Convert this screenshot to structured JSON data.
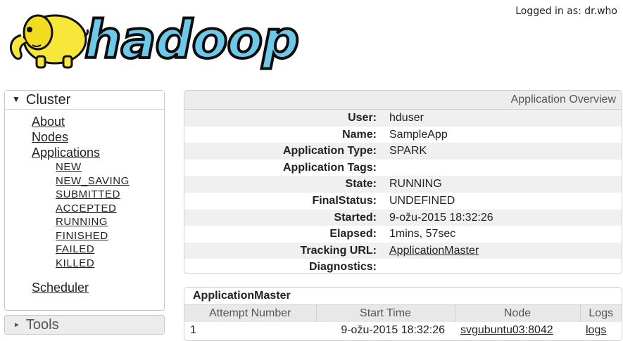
{
  "header": {
    "logo_text": "hadoop",
    "logged_in": "Logged in as: dr.who"
  },
  "sidebar": {
    "cluster": {
      "title": "Cluster",
      "links": [
        "About",
        "Nodes",
        "Applications"
      ],
      "app_states": [
        "NEW",
        "NEW_SAVING",
        "SUBMITTED",
        "ACCEPTED",
        "RUNNING",
        "FINISHED",
        "FAILED",
        "KILLED"
      ],
      "scheduler": "Scheduler"
    },
    "tools": {
      "title": "Tools"
    }
  },
  "overview": {
    "title": "Application Overview",
    "rows": [
      {
        "label": "User:",
        "value": "hduser"
      },
      {
        "label": "Name:",
        "value": "SampleApp"
      },
      {
        "label": "Application Type:",
        "value": "SPARK"
      },
      {
        "label": "Application Tags:",
        "value": ""
      },
      {
        "label": "State:",
        "value": "RUNNING"
      },
      {
        "label": "FinalStatus:",
        "value": "UNDEFINED"
      },
      {
        "label": "Started:",
        "value": "9-ožu-2015 18:32:26"
      },
      {
        "label": "Elapsed:",
        "value": "1mins, 57sec"
      },
      {
        "label": "Tracking URL:",
        "value": "ApplicationMaster"
      },
      {
        "label": "Diagnostics:",
        "value": ""
      }
    ]
  },
  "app_master": {
    "title": "ApplicationMaster",
    "columns": [
      "Attempt Number",
      "Start Time",
      "Node",
      "Logs"
    ],
    "row": {
      "attempt": "1",
      "start_time": "9-ožu-2015 18:32:26",
      "node": "svgubuntu03:8042",
      "logs": "logs"
    }
  }
}
